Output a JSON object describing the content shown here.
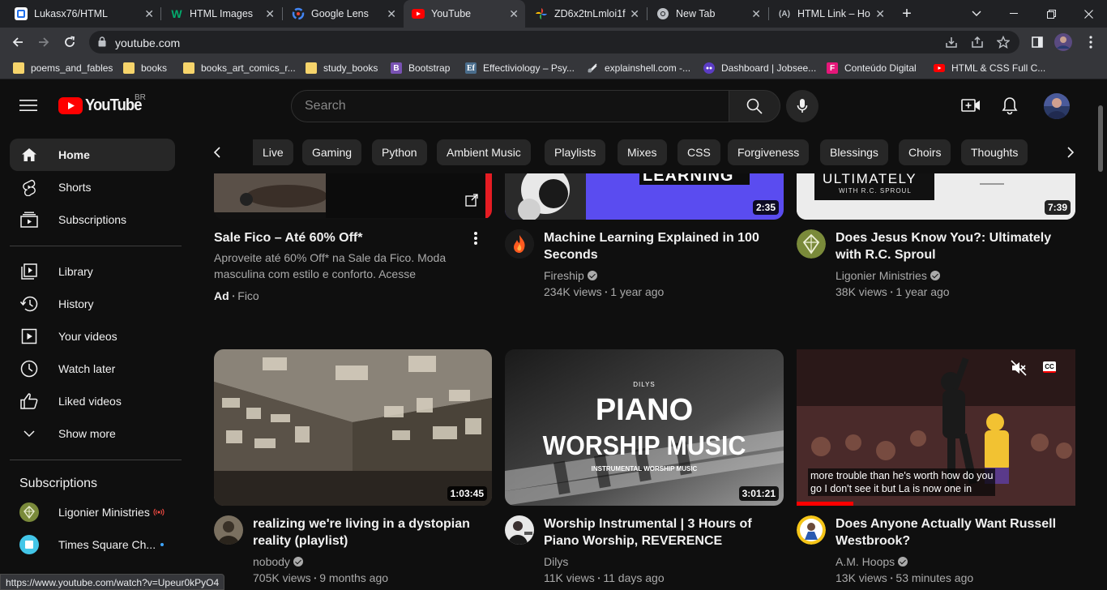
{
  "browser": {
    "tabs": [
      {
        "title": "Lukasx76/HTML",
        "icon": "github-icon"
      },
      {
        "title": "HTML Images",
        "icon": "w3schools-icon"
      },
      {
        "title": "Google Lens",
        "icon": "google-lens-icon"
      },
      {
        "title": "YouTube",
        "icon": "youtube-icon",
        "active": true
      },
      {
        "title": "ZD6x2tnLmloi1f",
        "icon": "google-photos-icon"
      },
      {
        "title": "New Tab",
        "icon": "chrome-icon"
      },
      {
        "title": "HTML Link – Ho",
        "icon": "freecodecamp-icon"
      }
    ],
    "new_tab": "+",
    "address": "youtube.com",
    "bookmarks": [
      {
        "label": "poems_and_fables",
        "icon": "folder-icon"
      },
      {
        "label": "books",
        "icon": "folder-icon"
      },
      {
        "label": "books_art_comics_r...",
        "icon": "folder-icon"
      },
      {
        "label": "study_books",
        "icon": "folder-icon"
      },
      {
        "label": "Bootstrap",
        "icon": "bootstrap-icon",
        "glyph": "B"
      },
      {
        "label": "Effectiviology – Psy...",
        "icon": "effectiviology-icon",
        "glyph": "Ef"
      },
      {
        "label": "explainshell.com -...",
        "icon": "explainshell-icon"
      },
      {
        "label": "Dashboard | Jobsee...",
        "icon": "jobseeker-icon"
      },
      {
        "label": "Conteúdo Digital",
        "icon": "conteudo-icon",
        "glyph": "F"
      },
      {
        "label": "HTML & CSS Full C...",
        "icon": "youtube-icon"
      }
    ],
    "status_url": "https://www.youtube.com/watch?v=Upeur0kPyO4"
  },
  "youtube": {
    "logo_text": "YouTube",
    "region": "BR",
    "search_placeholder": "Search",
    "sidebar": {
      "main": [
        {
          "label": "Home",
          "icon": "home-icon",
          "active": true
        },
        {
          "label": "Shorts",
          "icon": "shorts-icon"
        },
        {
          "label": "Subscriptions",
          "icon": "subscriptions-icon"
        }
      ],
      "library": [
        {
          "label": "Library",
          "icon": "library-icon"
        },
        {
          "label": "History",
          "icon": "history-icon"
        },
        {
          "label": "Your videos",
          "icon": "your-videos-icon"
        },
        {
          "label": "Watch later",
          "icon": "watch-later-icon"
        },
        {
          "label": "Liked videos",
          "icon": "liked-videos-icon"
        },
        {
          "label": "Show more",
          "icon": "chevron-down-icon"
        }
      ],
      "subscriptions_heading": "Subscriptions",
      "subscriptions": [
        {
          "label": "Ligonier Ministries",
          "live": true
        },
        {
          "label": "Times Square Ch...",
          "new": true
        }
      ]
    },
    "chips": [
      "Live",
      "Gaming",
      "Python",
      "Ambient Music",
      "Playlists",
      "Mixes",
      "CSS",
      "Forgiveness",
      "Blessings",
      "Choirs",
      "Thoughts"
    ],
    "videos": [
      {
        "title": "Sale Fico – Até 60% Off*",
        "description": "Aproveite até 60% Off* na Sale da Fico. Moda masculina com estilo e conforto. Acesse",
        "ad_label": "Ad",
        "advertiser": "Fico",
        "is_ad": true
      },
      {
        "title": "Machine Learning Explained in 100 Seconds",
        "channel": "Fireship",
        "views": "234K views",
        "age": "1 year ago",
        "duration": "2:35",
        "thumb_text": "LEARNING"
      },
      {
        "title": "Does Jesus Know You?: Ultimately with R.C. Sproul",
        "channel": "Ligonier Ministries",
        "views": "38K views",
        "age": "1 year ago",
        "duration": "7:39",
        "thumb_text": "ULTIMATELY",
        "thumb_sub": "WITH R.C. SPROUL"
      },
      {
        "title": "realizing we're living in a dystopian reality (playlist)",
        "channel": "nobody",
        "views": "705K views",
        "age": "9 months ago",
        "duration": "1:03:45"
      },
      {
        "title": "Worship Instrumental | 3 Hours of Piano Worship, REVERENCE",
        "channel": "Dilys",
        "views": "11K views",
        "age": "11 days ago",
        "duration": "3:01:21",
        "thumb_brand": "DILYS",
        "thumb_line1": "PIANO",
        "thumb_line2": "WORSHIP MUSIC",
        "thumb_line3": "INSTRUMENTAL WORSHIP MUSIC"
      },
      {
        "title": "Does Anyone Actually Want Russell Westbrook?",
        "channel": "A.M. Hoops",
        "views": "13K views",
        "age": "53 minutes ago",
        "caption_line1": "more trouble than he's worth how do you",
        "caption_line2": "go I don't see it but La is now one in",
        "cc_label": "CC"
      }
    ],
    "meta_separator": "•"
  },
  "colors": {
    "youtube_red": "#ff0000",
    "background": "#0f0f0f",
    "chip": "#272727",
    "live_red": "#ff4e45",
    "new_dot": "#3ea6ff"
  }
}
